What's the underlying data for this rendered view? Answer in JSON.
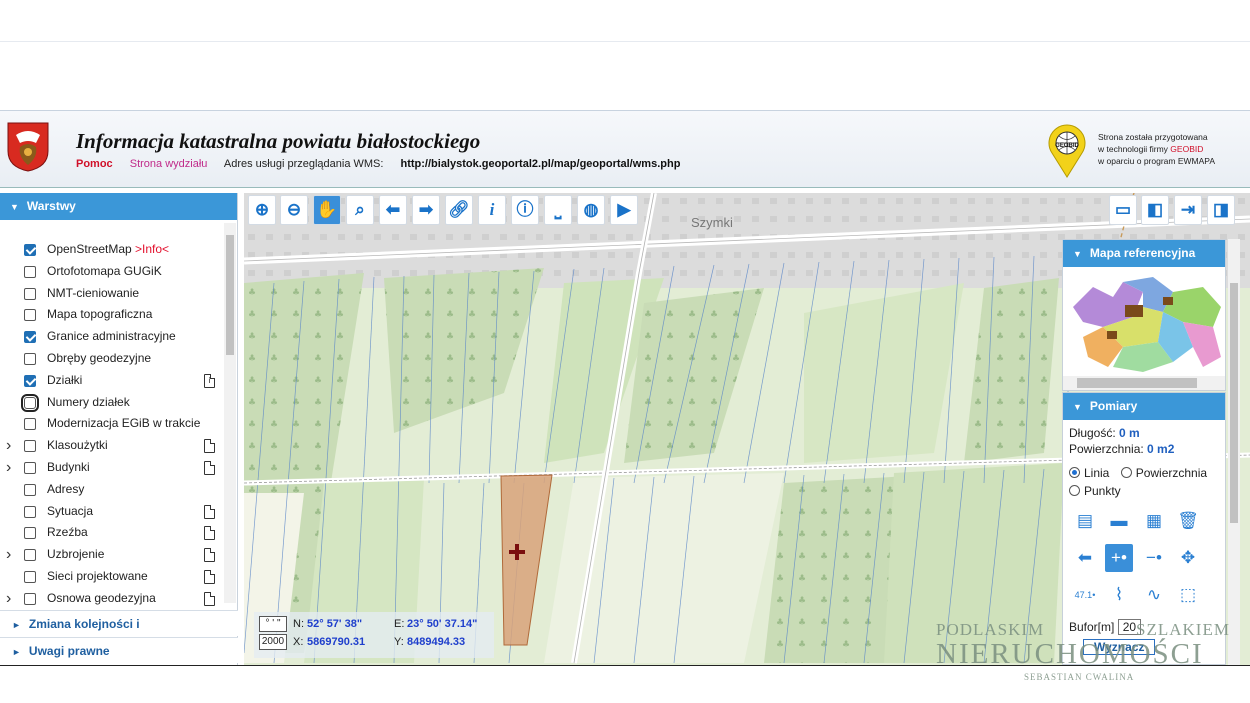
{
  "header": {
    "title": "Informacja katastralna powiatu białostockiego",
    "links": {
      "help": "Pomoc",
      "dept": "Strona wydziału"
    },
    "wms_label": "Adres usługi przeglądania WMS:",
    "wms_url": "http://bialystok.geoportal2.pl/map/geoportal/wms.php",
    "credit_line1": "Strona została przygotowana",
    "credit_line2_prefix": "w technologii firmy",
    "credit_brand": "GEOBID",
    "credit_line3": "w oparciu o program EWMAPA",
    "logo_text": "GEOBID"
  },
  "left_panel": {
    "layers_heading": "Warstwy",
    "layers": [
      {
        "label": "OpenStreetMap",
        "suffix": ">Info<",
        "checked": true,
        "expandable": false,
        "doc": false
      },
      {
        "label": "Ortofotomapa GUGiK",
        "checked": false,
        "expandable": false,
        "doc": false
      },
      {
        "label": "NMT-cieniowanie",
        "checked": false,
        "expandable": false,
        "doc": false
      },
      {
        "label": "Mapa topograficzna",
        "checked": false,
        "expandable": false,
        "doc": false
      },
      {
        "label": "Granice administracyjne",
        "checked": true,
        "expandable": false,
        "doc": false
      },
      {
        "label": "Obręby geodezyjne",
        "checked": false,
        "expandable": false,
        "doc": false
      },
      {
        "label": "Działki",
        "checked": true,
        "expandable": false,
        "doc": true,
        "doc_kind": "info"
      },
      {
        "label": "Numery działek",
        "checked": false,
        "expandable": false,
        "doc": false,
        "focused": true
      },
      {
        "label": "Modernizacja EGiB w trakcie",
        "checked": false,
        "expandable": false,
        "doc": false
      },
      {
        "label": "Klasoużytki",
        "checked": false,
        "expandable": true,
        "doc": true
      },
      {
        "label": "Budynki",
        "checked": false,
        "expandable": true,
        "doc": true
      },
      {
        "label": "Adresy",
        "checked": false,
        "expandable": false,
        "doc": false
      },
      {
        "label": "Sytuacja",
        "checked": false,
        "expandable": false,
        "doc": true
      },
      {
        "label": "Rzeźba",
        "checked": false,
        "expandable": false,
        "doc": true
      },
      {
        "label": "Uzbrojenie",
        "checked": false,
        "expandable": true,
        "doc": true
      },
      {
        "label": "Sieci projektowane",
        "checked": false,
        "expandable": false,
        "doc": true
      },
      {
        "label": "Osnowa geodezyjna",
        "checked": false,
        "expandable": true,
        "doc": true
      }
    ],
    "order_heading": "Zmiana kolejności i przezroczystości",
    "legal_heading": "Uwagi prawne"
  },
  "map": {
    "place_label": "Szymki"
  },
  "toolbar": {
    "tools": [
      "zoom-in",
      "zoom-out",
      "pan",
      "zoom-box",
      "back",
      "forward",
      "link",
      "info",
      "identify",
      "measure",
      "globe",
      "video"
    ],
    "active_tool": "pan",
    "right_tools": [
      "layout-full",
      "layout-left",
      "export",
      "layout-right"
    ]
  },
  "ref_map": {
    "heading": "Mapa referencyjna"
  },
  "measure": {
    "heading": "Pomiary",
    "length_label": "Długość:",
    "length_value": "0 m",
    "area_label": "Powierzchnia:",
    "area_value": "0 m2",
    "mode_line": "Linia",
    "mode_area": "Powierzchnia",
    "mode_points": "Punkty",
    "selected_mode": "Linia",
    "buffer_label": "Bufor[m]",
    "buffer_value": "20",
    "compute_label": "Wyznacz",
    "tool_label_value": "47.1"
  },
  "coords": {
    "dms_toggle": "° ' \"",
    "n_label": "N:",
    "n_value": "52° 57' 38\"",
    "e_label": "E:",
    "e_value": "23° 50' 37.14\"",
    "crs": "2000",
    "x_label": "X:",
    "x_value": "5869790.31",
    "y_label": "Y:",
    "y_value": "8489494.33"
  },
  "watermark": {
    "line1_left": "PODLASKIM",
    "line1_right": "SZLAKIEM",
    "line2": "NIERUCHOMOŚCI",
    "line3": "SEBASTIAN CWALINA"
  }
}
